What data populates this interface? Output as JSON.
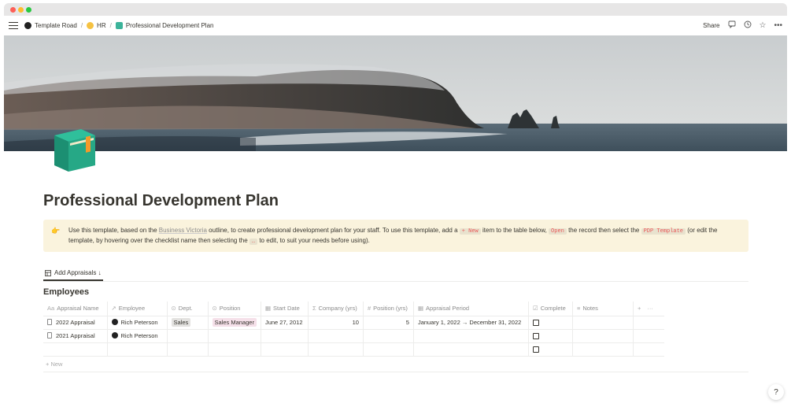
{
  "breadcrumb": {
    "workspace": "Template Road",
    "section": "HR",
    "page": "Professional Development Plan"
  },
  "topbar": {
    "share_label": "Share"
  },
  "page": {
    "title": "Professional Development Plan"
  },
  "callout": {
    "part1": "Use this template, based on the ",
    "link": "Business Victoria",
    "part2": " outline, to create professional development plan for your staff. To use this template, add a ",
    "code_new": "+ New",
    "part3": " item to the table below, ",
    "code_open": "Open",
    "part4": " the record then select the ",
    "code_pdp": "PDP Template",
    "part5": " (or edit the template, by hovering over the checklist name then selecting the ",
    "code_dots": "…",
    "part6": " to edit, to suit your needs before using)."
  },
  "view_tab": {
    "label": "Add Appraisals ↓"
  },
  "database": {
    "title": "Employees",
    "columns": [
      "Appraisal Name",
      "Employee",
      "Dept.",
      "Position",
      "Start Date",
      "Company (yrs)",
      "Position (yrs)",
      "Appraisal Period",
      "Complete",
      "Notes"
    ],
    "rows": [
      {
        "name": "2022 Appraisal",
        "employee": "Rich Peterson",
        "dept": "Sales",
        "position": "Sales Manager",
        "start_date": "June 27, 2012",
        "company_yrs": "10",
        "position_yrs": "5",
        "period": "January 1, 2022 → December 31, 2022",
        "complete": false,
        "notes": ""
      },
      {
        "name": "2021 Appraisal",
        "employee": "Rich Peterson",
        "dept": "",
        "position": "",
        "start_date": "",
        "company_yrs": "",
        "position_yrs": "",
        "period": "",
        "complete": false,
        "notes": ""
      },
      {
        "name": "",
        "employee": "",
        "dept": "",
        "position": "",
        "start_date": "",
        "company_yrs": "",
        "position_yrs": "",
        "period": "",
        "complete": false,
        "notes": ""
      }
    ],
    "new_label": "+ New"
  },
  "help_label": "?",
  "colors": {
    "callout_bg": "#faf3dd",
    "code_red": "#eb5757",
    "tag_gray": "#e3e2e0",
    "tag_pink": "#f5e0e9"
  }
}
